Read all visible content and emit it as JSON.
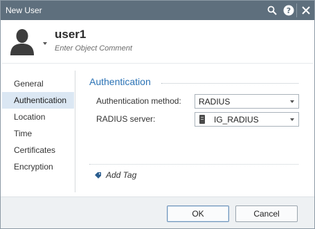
{
  "window": {
    "title": "New User"
  },
  "titlebar_icons": [
    "search-icon",
    "help-icon",
    "close-icon"
  ],
  "header": {
    "name": "user1",
    "comment_placeholder": "Enter Object Comment",
    "avatar_icon": "user-avatar-icon"
  },
  "sidebar": {
    "items": [
      {
        "label": "General",
        "active": false
      },
      {
        "label": "Authentication",
        "active": true
      },
      {
        "label": "Location",
        "active": false
      },
      {
        "label": "Time",
        "active": false
      },
      {
        "label": "Certificates",
        "active": false
      },
      {
        "label": "Encryption",
        "active": false
      }
    ]
  },
  "main": {
    "section_title": "Authentication",
    "auth_method": {
      "label": "Authentication method:",
      "value": "RADIUS"
    },
    "radius_server": {
      "label": "RADIUS server:",
      "value": "IG_RADIUS",
      "icon": "server-icon"
    },
    "add_tag_label": "Add Tag"
  },
  "footer": {
    "ok_label": "OK",
    "cancel_label": "Cancel"
  },
  "colors": {
    "titlebar": "#5e6f7d",
    "accent": "#2a72b5",
    "selected_nav": "#dbe7f3"
  }
}
